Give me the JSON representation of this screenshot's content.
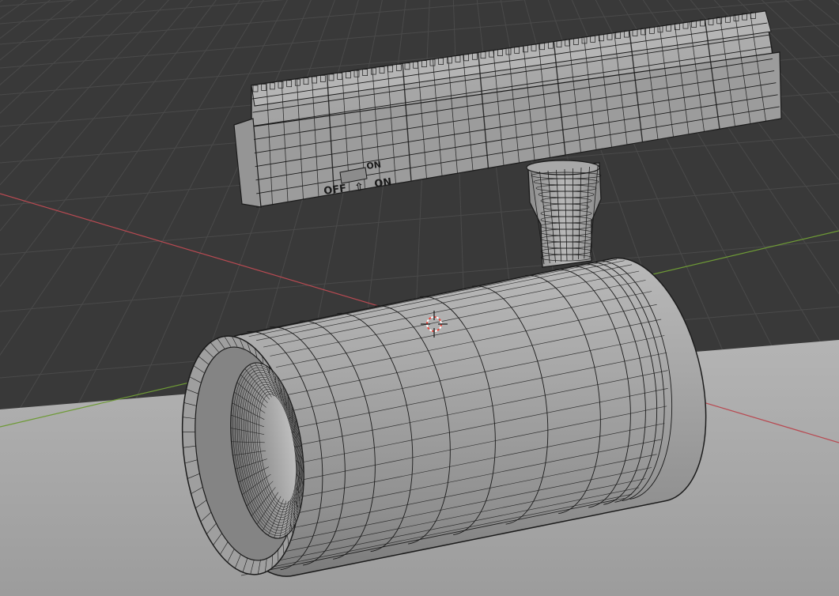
{
  "viewport": {
    "colors": {
      "background": "#393939",
      "grid_line": "#4a4a4a",
      "floor": "#a9a9a9",
      "x_axis": "#b84a52",
      "y_axis": "#6e9a36",
      "mesh_fill": "#a3a3a3",
      "wire": "#1b1b1b",
      "cursor_red": "#e8463c"
    },
    "model": {
      "switch_labels": {
        "off": "OFF",
        "on": "ON",
        "top": "ON"
      }
    }
  }
}
